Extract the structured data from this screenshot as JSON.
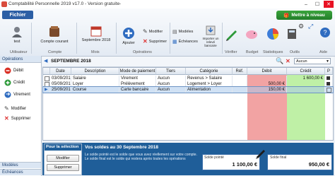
{
  "window": {
    "title": "Comptabilité Personnelle 2019 v17.0 - Version gratuite-",
    "controls": [
      "–",
      "☐",
      "✕"
    ]
  },
  "ribbon": {
    "file_menu": "Fichier",
    "upgrade_button": "Mettre à niveau",
    "account_user": "test",
    "account_type": "Compte courant",
    "month": "Septembre 2018",
    "add_label": "Ajouter",
    "modify_label": "Modifier",
    "delete_label": "Supprimer",
    "templates_label": "Modèles",
    "schedules_label": "Échéances",
    "import_label": "Importer un relevé bancaire",
    "group_labels": [
      "Utilisateur",
      "Compte",
      "Mois",
      "Opérations",
      "",
      "",
      "Vérifier",
      "Budget",
      "Statistiques",
      "Outils",
      "Aide"
    ]
  },
  "sidebar": {
    "header": "Opérations",
    "items": [
      "Débit",
      "Crédit",
      "Virement",
      "Modifier",
      "Supprimer"
    ],
    "footer": [
      "Modèles",
      "Échéances"
    ]
  },
  "month_tab": "SEPTEMBRE 2018",
  "search": {
    "filter_value": "Aucun"
  },
  "table": {
    "headers": [
      "",
      "Date",
      "Description",
      "Mode de paiement",
      "Tiers",
      "Catégorie",
      "Réf.",
      "Débit",
      "Crédit",
      "P"
    ],
    "rows": [
      {
        "date": "03/09/2018",
        "desc": "Salaire",
        "mode": "Virement",
        "tiers": "Aucun",
        "cat": "Revenus > Salaire",
        "ref": "",
        "debit": "",
        "credit": "1 600,00 €",
        "checked": true
      },
      {
        "date": "05/09/2018",
        "desc": "Loyer",
        "mode": "Prélèvement",
        "tiers": "Aucun",
        "cat": "Logement > Loyer",
        "ref": "",
        "debit": "500,00 €",
        "credit": "",
        "checked": true
      },
      {
        "date": "25/09/2018",
        "desc": "Course",
        "mode": "Carte bancaire",
        "tiers": "Aucun",
        "cat": "Alimentation",
        "ref": "",
        "debit": "150,00 €",
        "credit": "",
        "checked": false
      }
    ]
  },
  "selection": {
    "title": "Pour la sélection",
    "modify": "Modifier",
    "delete": "Supprimer"
  },
  "summary": {
    "title": "Vos soldes au 30 Septembre 2018",
    "text": "Le solde pointé est le solde que vous avez réellement sur votre compte. Le solde final est le solde qui restera après toutes les opérations",
    "solde_pointe_label": "Solde pointé",
    "solde_pointe_value": "1 100,00 €",
    "solde_final_label": "Solde final",
    "solde_final_value": "950,00 €"
  },
  "colors": {
    "debit": "#f2a3a3",
    "credit": "#bff0a6",
    "brand": "#2c5fa5",
    "upgrade": "#2f9236"
  }
}
